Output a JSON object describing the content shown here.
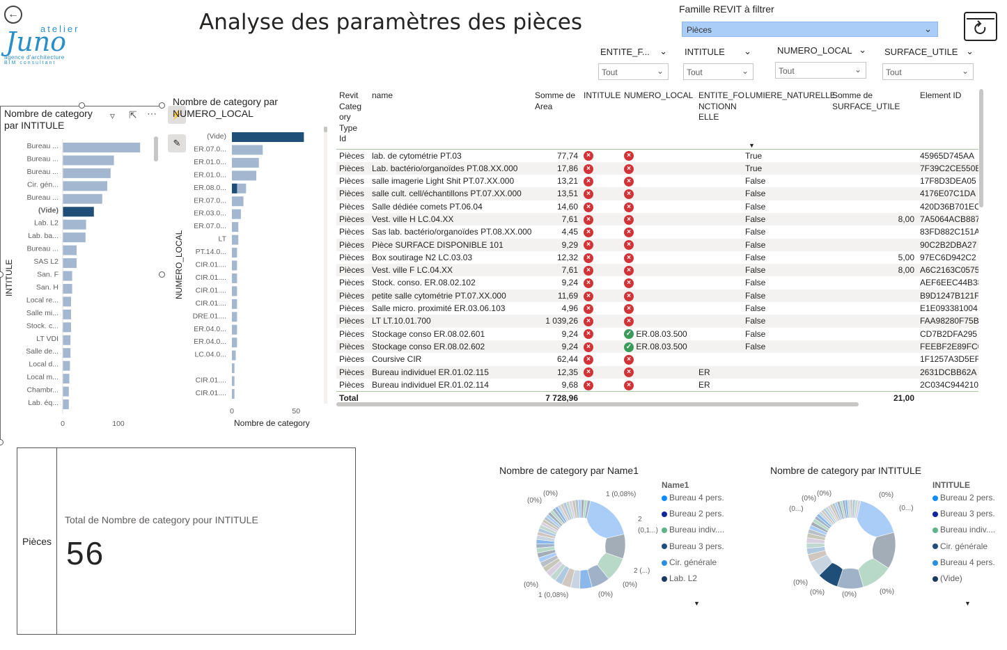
{
  "header": {
    "title": "Analyse des paramètres des pièces",
    "logo": {
      "line1": "atelier",
      "line2": "Juno",
      "line3": "agence d'architecture",
      "line4": "BIM consultant"
    },
    "famille_label": "Famille REVIT à filtrer",
    "famille_value": "Pièces"
  },
  "slicers": [
    {
      "label": "ENTITE_F...",
      "value": "Tout"
    },
    {
      "label": "INTITULE",
      "value": "Tout"
    },
    {
      "label": "NUMERO_LOCAL",
      "value": "Tout"
    },
    {
      "label": "SURFACE_UTILE",
      "value": "Tout"
    }
  ],
  "colors": {
    "bar": "#a3b8d0",
    "bar_highlight": "#1f4e79",
    "filter_blue": "#a9cdf7",
    "error_red": "#d13438",
    "ok_green": "#3a9a5a"
  },
  "chart1": {
    "title": "Nombre de category par INTITULE",
    "ylabel": "INTITULE",
    "xticks": [
      "0",
      "100"
    ],
    "icons": [
      "filter-icon",
      "focus-mode-icon",
      "more-options-icon"
    ]
  },
  "chart2": {
    "title": "Nombre de category par NUMERO_LOCAL",
    "ylabel": "NUMERO_LOCAL",
    "xlabel": "Nombre de category",
    "xticks": [
      "0",
      "50"
    ]
  },
  "chart_data": [
    {
      "type": "bar",
      "title": "Nombre de category par INTITULE",
      "ylabel": "INTITULE",
      "categories": [
        "Bureau ...",
        "Bureau ...",
        "Bureau ...",
        "Cir. gén...",
        "Bureau ...",
        "(Vide)",
        "Lab. L2",
        "Lab. ba...",
        "Bureau ...",
        "SAS L2",
        "San. F",
        "San. H",
        "Local re...",
        "Salle mi...",
        "Stock. c...",
        "LT VDI",
        "Salle de...",
        "Local d...",
        "Local m...",
        "Chambr...",
        "Lab. éq..."
      ],
      "values": [
        139,
        92,
        86,
        80,
        71,
        56,
        42,
        41,
        25,
        25,
        17,
        17,
        15,
        15,
        15,
        14,
        14,
        13,
        12,
        11,
        11
      ],
      "highlight_index": 5,
      "xlim": [
        0,
        150
      ]
    },
    {
      "type": "bar",
      "title": "Nombre de category par NUMERO_LOCAL",
      "ylabel": "NUMERO_LOCAL",
      "xlabel": "Nombre de category",
      "categories": [
        "(Vide)",
        "ER.07.0...",
        "ER.01.0...",
        "ER.01.0...",
        "ER.08.0...",
        "ER.07.0...",
        "ER.03.0...",
        "ER.07.0...",
        "LT",
        "PT.14.0...",
        "CIR.01....",
        "CIR.01....",
        "CIR.01....",
        "CIR.01....",
        "DRE.01....",
        "ER.04.0...",
        "ER.04.0...",
        "LC.04.0...",
        "",
        "CIR.01....",
        "CIR.01...."
      ],
      "values": [
        56,
        24,
        21,
        19,
        11,
        9,
        7,
        5,
        5,
        4,
        4,
        4,
        4,
        4,
        4,
        4,
        4,
        3,
        2,
        2,
        2
      ],
      "highlight_values": [
        56,
        0,
        0,
        0,
        4,
        0,
        0,
        0,
        0,
        0,
        0,
        0,
        0,
        0,
        0,
        0,
        0,
        0,
        0,
        0,
        0
      ],
      "xlim": [
        0,
        58
      ]
    }
  ],
  "table": {
    "columns": [
      "Revit Category Type Id",
      "name",
      "Somme de Area",
      "INTITULE",
      "NUMERO_LOCAL",
      "ENTITE_FONCTIONNELLE",
      "LUMIERE_NATURELLE",
      "Somme de SURFACE_UTILE",
      "Element ID"
    ],
    "column_display": [
      "Revit\nCateg\nory\nType\nId",
      "name",
      "Somme de\nArea",
      "INTITULE",
      "NUMERO_LOCAL",
      "ENTITE_FO\nNCTIONN\nELLE",
      "LUMIERE_NATURELLE",
      "Somme de\nSURFACE_UTILE",
      "Element ID"
    ],
    "rows": [
      [
        "Pièces",
        "lab. de cytométrie PT.03",
        "77,74",
        "x",
        "x",
        "",
        "True",
        "",
        "45965D745AA"
      ],
      [
        "Pièces",
        "Lab. bactério/organoïdes PT.08.XX.000",
        "17,86",
        "x",
        "x",
        "",
        "True",
        "",
        "7F39C2CE550E"
      ],
      [
        "Pièces",
        "salle imagerie Light Shit PT.07.XX.000",
        "13,21",
        "x",
        "x",
        "",
        "False",
        "",
        "17F8D3DEA05"
      ],
      [
        "Pièces",
        "salle cult. cell/échantillons PT.07.XX.000",
        "13,51",
        "x",
        "x",
        "",
        "False",
        "",
        "4176E07C1DA"
      ],
      [
        "Pièces",
        "Salle dédiée comets PT.06.04",
        "14,60",
        "x",
        "x",
        "",
        "False",
        "",
        "420D36B701EC"
      ],
      [
        "Pièces",
        "Vest. ville H LC.04.XX",
        "7,61",
        "x",
        "x",
        "",
        "False",
        "8,00",
        "7A5064ACB887"
      ],
      [
        "Pièces",
        "Sas lab. bactério/organoïdes PT.08.XX.000",
        "4,45",
        "x",
        "x",
        "",
        "False",
        "",
        "83FD882C151A"
      ],
      [
        "Pièces",
        "Pièce SURFACE DISPONIBLE 101",
        "9,29",
        "x",
        "x",
        "",
        "False",
        "",
        "90C2B2DBA27"
      ],
      [
        "Pièces",
        "Box soutirage N2 LC.03.03",
        "12,32",
        "x",
        "x",
        "",
        "False",
        "5,00",
        "97EC6D942C2"
      ],
      [
        "Pièces",
        "Vest. ville F LC.04.XX",
        "7,61",
        "x",
        "x",
        "",
        "False",
        "8,00",
        "A6C2163C0575"
      ],
      [
        "Pièces",
        "Stock. conso. ER.08.02.102",
        "9,24",
        "x",
        "x",
        "",
        "False",
        "",
        "AEF6EEC44B38"
      ],
      [
        "Pièces",
        "petite salle cytométrie PT.07.XX.000",
        "11,69",
        "x",
        "x",
        "",
        "False",
        "",
        "B9D1247B121F"
      ],
      [
        "Pièces",
        "Salle micro. proximité ER.03.06.103",
        "4,96",
        "x",
        "x",
        "",
        "False",
        "",
        "E1E093381004"
      ],
      [
        "Pièces",
        "LT LT.10.01.700",
        "1 039,26",
        "x",
        "x",
        "",
        "False",
        "",
        "FAA98280F75B"
      ],
      [
        "Pièces",
        "Stockage conso ER.08.02.601",
        "9,24",
        "x",
        "ok:ER.08.03.500",
        "",
        "False",
        "",
        "CD7B2DFA295"
      ],
      [
        "Pièces",
        "Stockage conso ER.08.02.602",
        "9,24",
        "x",
        "ok:ER.08.03.500",
        "",
        "False",
        "",
        "FEEBF2E89FC0"
      ],
      [
        "Pièces",
        "Coursive CIR",
        "62,44",
        "x",
        "x",
        "",
        "",
        "",
        "1F1257A3D5EF"
      ],
      [
        "Pièces",
        "Bureau individuel ER.01.02.115",
        "12,35",
        "x",
        "x",
        "ER",
        "",
        "",
        "2631DCBB62A"
      ],
      [
        "Pièces",
        "Bureau individuel ER.01.02.114",
        "9,68",
        "x",
        "x",
        "ER",
        "",
        "",
        "2C034C944210"
      ]
    ],
    "total": {
      "label": "Total",
      "area": "7 728,96",
      "surface_utile": "21,00"
    }
  },
  "card": {
    "category": "Pièces",
    "label": "Total de Nombre de category pour INTITULE",
    "value": "56"
  },
  "donut1": {
    "title": "Nombre de category par Name1",
    "legend_title": "Name1",
    "legend": [
      {
        "label": "Bureau 4 pers.",
        "color": "#118dff"
      },
      {
        "label": "Bureau 2 pers.",
        "color": "#12239e"
      },
      {
        "label": "Bureau indiv....",
        "color": "#5fb38a"
      },
      {
        "label": "Bureau 3 pers.",
        "color": "#1f4e79"
      },
      {
        "label": "Cir. générale",
        "color": "#2b8fe0"
      },
      {
        "label": "Lab. L2",
        "color": "#1b3a5c"
      }
    ],
    "labels": [
      "(0%)",
      "(0%)",
      "1 (0,08%)",
      "2",
      "(0,1...)",
      "2 (...)",
      "(0%)",
      "(0%)",
      "(0%)",
      "1 (0,08%)"
    ]
  },
  "donut2": {
    "title": "Nombre de category par INTITULE",
    "legend_title": "INTITULE",
    "legend": [
      {
        "label": "Bureau 2 pers.",
        "color": "#118dff"
      },
      {
        "label": "Bureau 3 pers.",
        "color": "#12239e"
      },
      {
        "label": "Bureau indiv....",
        "color": "#5fb38a"
      },
      {
        "label": "Cir. générale",
        "color": "#1f4e79"
      },
      {
        "label": "Bureau 4 pers.",
        "color": "#2b8fe0"
      },
      {
        "label": "(Vide)",
        "color": "#1b3a5c"
      }
    ],
    "labels": [
      "(0%)",
      "(0%)",
      "(0...)",
      "(0%)",
      "(0...)",
      "(0%)",
      "(0%)",
      "(0%)",
      "(0%)"
    ]
  },
  "donut_data": {
    "donut1": [
      8,
      4,
      4,
      3,
      2,
      1.5,
      1.5,
      1.2,
      1,
      1,
      0.9,
      0.9,
      0.8,
      0.8,
      0.8,
      0.7,
      0.7,
      0.7,
      0.6,
      0.6,
      0.6,
      0.5,
      0.5,
      0.5,
      0.5,
      0.5,
      0.5,
      0.5,
      0.5,
      0.5,
      0.5,
      0.5,
      0.5,
      0.5,
      0.5,
      0.5,
      0.5,
      0.5,
      0.5,
      0.5
    ],
    "donut2": [
      9,
      7,
      6,
      5,
      4,
      3,
      1.5,
      1.2,
      1,
      1,
      0.9,
      0.8,
      0.8,
      0.7,
      0.7,
      0.6,
      0.6,
      0.6,
      0.5,
      0.5,
      0.5,
      0.5,
      0.5,
      0.5,
      0.5,
      0.5,
      0.5,
      0.5,
      0.5,
      0.5,
      0.5,
      0.5,
      0.5,
      0.5
    ]
  }
}
